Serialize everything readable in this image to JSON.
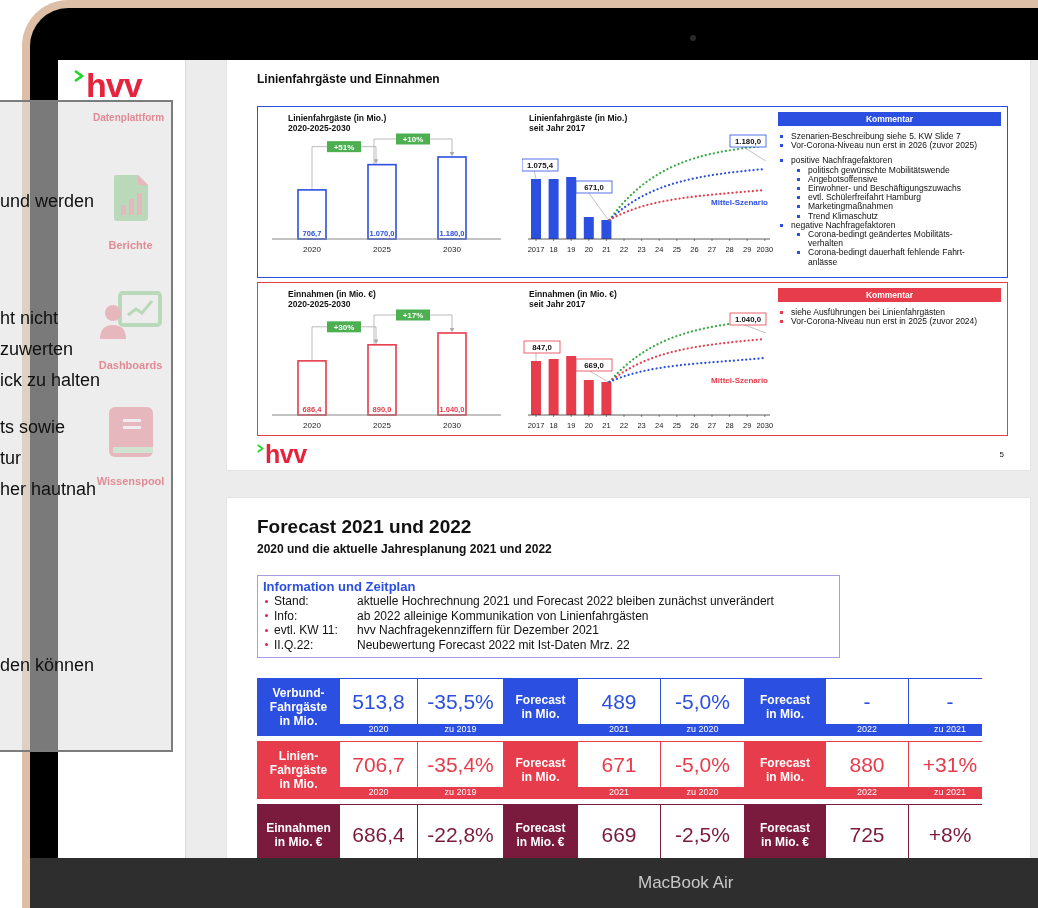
{
  "device": {
    "label": "MacBook Air"
  },
  "sidebar": {
    "logo": "hvv",
    "subtitle": "Datenplattform",
    "items": [
      {
        "label": "Berichte",
        "kind": "report"
      },
      {
        "label": "Dashboards",
        "kind": "dashboard"
      },
      {
        "label": "Wissenspool",
        "kind": "book"
      }
    ]
  },
  "overlay": {
    "lines": [
      "und werden",
      "ht nicht",
      "zuwerten",
      "ick zu halten",
      "ts sowie",
      "tur",
      "her hautnah",
      "den können"
    ]
  },
  "slide_5": {
    "subtitle": "Linienfahrgäste und Einnahmen",
    "sections": [
      {
        "color": "#2b4fe0",
        "bar_chart": {
          "heading": "Linienfahrgäste (in Mio.)\n2020-2025-2030",
          "chart_data": {
            "type": "bar",
            "categories": [
              "2020",
              "2025",
              "2030"
            ],
            "values": [
              706.7,
              1070.0,
              1180.0
            ],
            "value_labels": [
              "706,7",
              "1.070,0",
              "1.180,0"
            ],
            "annotations": [
              "+51%",
              "+10%"
            ]
          }
        },
        "trend_chart": {
          "heading": "Linienfahrgäste (in Mio.)\nseit Jahr 2017",
          "x_labels": [
            "2017",
            "18",
            "19",
            "20",
            "21",
            "22",
            "23",
            "24",
            "25",
            "26",
            "27",
            "28",
            "29",
            "2030"
          ],
          "callouts": [
            "1.075,4",
            "671,0",
            "1.180,0"
          ],
          "scenario_label": "Mittel-Szenario"
        },
        "comment": {
          "heading": "Kommentar",
          "groups": [
            [
              {
                "text": "Szenarien-Beschreibung siehe 5. KW Slide 7"
              },
              {
                "text": "Vor-Corona-Niveau nun erst in 2026 (zuvor 2025)"
              }
            ],
            [
              {
                "text": "positive Nachfragefaktoren",
                "children": [
                  "politisch gewünschte Mobilitätswende",
                  "Angebotsoffensive",
                  "Einwohner- und Beschäftigungszuwachs",
                  "evtl. Schülerfreifahrt Hamburg",
                  "Marketingmaßnahmen",
                  "Trend Klimaschutz"
                ]
              },
              {
                "text": "negative Nachfragefaktoren",
                "children": [
                  "Corona-bedingt geändertes Mobilitäts-verhalten",
                  "Corona-bedingt dauerhaft fehlende Fahrt-anlässe"
                ]
              }
            ]
          ]
        }
      },
      {
        "color": "#e63c4b",
        "bar_chart": {
          "heading": "Einnahmen (in Mio. €)\n2020-2025-2030",
          "chart_data": {
            "type": "bar",
            "categories": [
              "2020",
              "2025",
              "2030"
            ],
            "values": [
              686.4,
              890.0,
              1040.0
            ],
            "value_labels": [
              "686,4",
              "890,0",
              "1.040,0"
            ],
            "annotations": [
              "+30%",
              "+17%"
            ]
          }
        },
        "trend_chart": {
          "heading": "Einnahmen (in Mio. €)\nseit Jahr 2017",
          "x_labels": [
            "2017",
            "18",
            "19",
            "20",
            "21",
            "22",
            "23",
            "24",
            "25",
            "26",
            "27",
            "28",
            "29",
            "2030"
          ],
          "callouts": [
            "847,0",
            "669,0",
            "1.040,0"
          ],
          "scenario_label": "Mittel-Szenario"
        },
        "comment": {
          "heading": "Kommentar",
          "groups": [
            [
              {
                "text": "siehe Ausführungen bei Linienfahrgästen"
              },
              {
                "text": "Vor-Corona-Niveau nun erst in 2025 (zuvor 2024)"
              }
            ]
          ]
        }
      }
    ],
    "footer_logo": "hvv",
    "page_number": "5"
  },
  "forecast_slide": {
    "title": "Forecast 2021 und 2022",
    "subtitle": "2020 und die aktuelle Jahresplanung 2021 und 2022",
    "info": {
      "heading": "Information und Zeitplan",
      "rows": [
        {
          "label": "Stand:",
          "text": "aktuelle Hochrechnung 2021 und Forecast 2022 bleiben zunächst unverändert"
        },
        {
          "label": "Info:",
          "text": "ab 2022 alleinige Kommunikation von Linienfahrgästen"
        },
        {
          "label": "evtl. KW 11:",
          "text": "hvv Nachfragekennziffern für Dezember 2021"
        },
        {
          "label": "II.Q.22:",
          "text": "Neubewertung Forecast 2022 mit Ist-Daten Mrz. 22"
        }
      ]
    },
    "kpi_rows": [
      {
        "color": "#2b4fe0",
        "blocks": [
          {
            "label": "Verbund-\nFahrgäste\nin Mio.",
            "cells": [
              {
                "value": "513,8",
                "caption": "2020"
              },
              {
                "value": "-35,5%",
                "caption": "zu 2019"
              }
            ]
          },
          {
            "label": "Forecast\nin Mio.",
            "cells": [
              {
                "value": "489",
                "caption": "2021"
              },
              {
                "value": "-5,0%",
                "caption": "zu 2020"
              }
            ]
          },
          {
            "label": "Forecast\nin Mio.",
            "cells": [
              {
                "value": "-",
                "caption": "2022"
              },
              {
                "value": "-",
                "caption": "zu 2021"
              }
            ]
          }
        ]
      },
      {
        "color": "#e63c4b",
        "blocks": [
          {
            "label": "Linien-\nFahrgäste\nin Mio.",
            "cells": [
              {
                "value": "706,7",
                "caption": "2020"
              },
              {
                "value": "-35,4%",
                "caption": "zu 2019"
              }
            ]
          },
          {
            "label": "Forecast\nin Mio.",
            "cells": [
              {
                "value": "671",
                "caption": "2021"
              },
              {
                "value": "-5,0%",
                "caption": "zu 2020"
              }
            ]
          },
          {
            "label": "Forecast\nin Mio.",
            "cells": [
              {
                "value": "880",
                "caption": "2022"
              },
              {
                "value": "+31%",
                "caption": "zu 2021"
              }
            ]
          }
        ]
      },
      {
        "color": "#7a1a3c",
        "blocks": [
          {
            "label": "Einnahmen\nin Mio. €",
            "cells": [
              {
                "value": "686,4"
              },
              {
                "value": "-22,8%"
              }
            ]
          },
          {
            "label": "Forecast\nin Mio. €",
            "cells": [
              {
                "value": "669"
              },
              {
                "value": "-2,5%"
              }
            ]
          },
          {
            "label": "Forecast\nin Mio. €",
            "cells": [
              {
                "value": "725"
              },
              {
                "value": "+8%"
              }
            ]
          }
        ]
      }
    ]
  }
}
